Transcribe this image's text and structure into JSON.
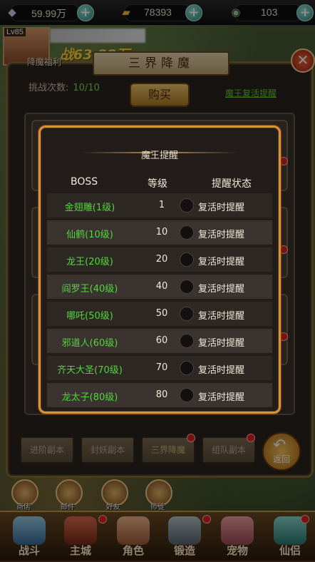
{
  "resources": [
    {
      "icon": "silver-ingot-icon",
      "value": "59.99万"
    },
    {
      "icon": "gold-ingot-icon",
      "value": "78393"
    },
    {
      "icon": "jade-coin-icon",
      "value": "103"
    }
  ],
  "player": {
    "level": "Lv85",
    "power": "战63.88万"
  },
  "panel": {
    "title": "三界降魔",
    "bonus": "降魔福利",
    "challenge_label": "挑战次数:",
    "challenge_value": "10/10",
    "buy_label": "购买",
    "remind_link": "魔王复活提醒",
    "tabs": [
      "进阶副本",
      "封妖副本",
      "三界降魔",
      "组队副本"
    ],
    "back_label": "返回"
  },
  "popup": {
    "title": "魔王提醒",
    "headers": {
      "boss": "BOSS",
      "level": "等级",
      "status": "提醒状态"
    },
    "rows": [
      {
        "name": "金翅雕(1级)",
        "level": "1",
        "status": "复活时提醒"
      },
      {
        "name": "仙鹤(10级)",
        "level": "10",
        "status": "复活时提醒"
      },
      {
        "name": "龙王(20级)",
        "level": "20",
        "status": "复活时提醒"
      },
      {
        "name": "阎罗王(40级)",
        "level": "40",
        "status": "复活时提醒"
      },
      {
        "name": "哪吒(50级)",
        "level": "50",
        "status": "复活时提醒"
      },
      {
        "name": "邪道人(60级)",
        "level": "60",
        "status": "复活时提醒"
      },
      {
        "name": "齐天大圣(70级)",
        "level": "70",
        "status": "复活时提醒"
      },
      {
        "name": "龙太子(80级)",
        "level": "80",
        "status": "复活时提醒"
      }
    ]
  },
  "shortcuts": [
    "商店",
    "邮件",
    "好友",
    "师徒"
  ],
  "nav": [
    "战斗",
    "主城",
    "角色",
    "锻造",
    "宠物",
    "仙侣"
  ]
}
